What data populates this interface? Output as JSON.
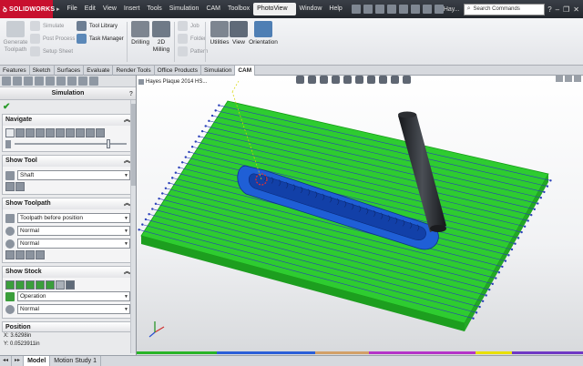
{
  "app": {
    "logo": "SOLIDWORKS",
    "menus": [
      "File",
      "Edit",
      "View",
      "Insert",
      "Tools",
      "Simulation",
      "CAM",
      "Toolbox",
      "PhotoView 360",
      "Window",
      "Help"
    ],
    "active_menu": "PhotoView 360",
    "user": "Hay...",
    "search_placeholder": "Search Commands"
  },
  "ribbon": {
    "generate_toolpath": "Generate Toolpath",
    "simulate": "Simulate",
    "post_process": "Post Process",
    "setup_sheet": "Setup Sheet",
    "tool_library": "Tool Library",
    "task_manager": "Task Manager",
    "drilling": "Drilling",
    "milling_2d": "2D Milling",
    "job": "Job",
    "folder": "Folder",
    "pattern": "Pattern",
    "utilities": "Utilities",
    "view": "View",
    "orientation": "Orientation"
  },
  "tabs": [
    "Features",
    "Sketch",
    "Surfaces",
    "Evaluate",
    "Render Tools",
    "Office Products",
    "Simulation",
    "CAM"
  ],
  "active_tab": "CAM",
  "panel": {
    "title": "Simulation",
    "help": "?",
    "navigate": {
      "title": "Navigate",
      "slider_position": 0.82
    },
    "show_tool": {
      "title": "Show Tool",
      "selected": "Shaft"
    },
    "show_toolpath": {
      "title": "Show Toolpath",
      "toolpath_mode": "Toolpath before position",
      "display_1": "Normal",
      "display_2": "Normal"
    },
    "show_stock": {
      "title": "Show Stock",
      "mode": "Operation",
      "display": "Normal"
    },
    "position": {
      "title": "Position",
      "x": "X: 3.6298in",
      "y": "Y: 0.0523911in"
    }
  },
  "viewport": {
    "breadcrumb": "Hayes Plaque 2014 HS...",
    "stock_color": "#2ecc30",
    "pocket_color": "#1f5fd6",
    "tool_color": "#2a2c30"
  },
  "timeline_colors": [
    "#28b428",
    "#2a5fd8",
    "#d2a068",
    "#b434c8",
    "#e8e000",
    "#6f39c4"
  ],
  "bottom_tabs": [
    "Model",
    "Motion Study 1"
  ],
  "active_bottom_tab": "Model"
}
